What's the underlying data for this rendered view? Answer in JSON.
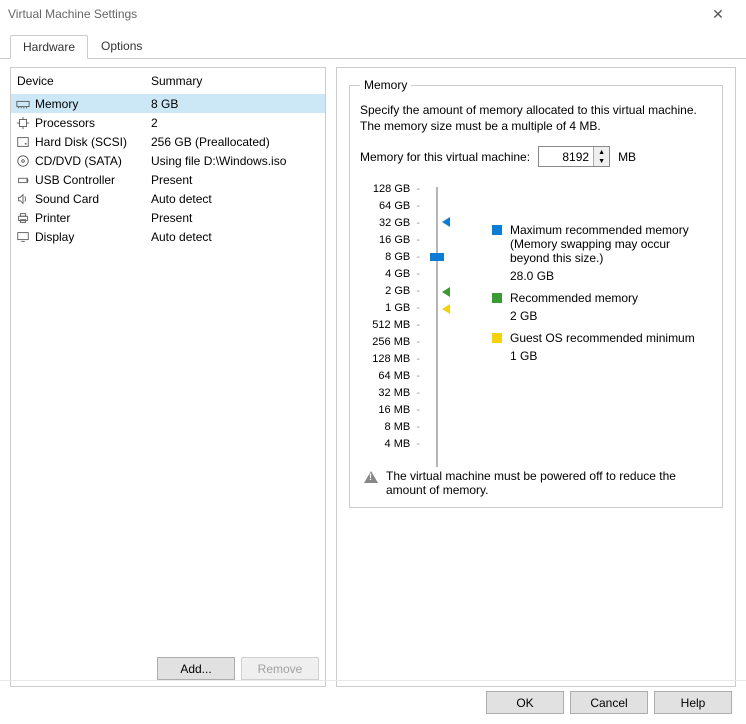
{
  "window": {
    "title": "Virtual Machine Settings"
  },
  "tabs": {
    "hardware": "Hardware",
    "options": "Options"
  },
  "deviceList": {
    "headers": {
      "device": "Device",
      "summary": "Summary"
    },
    "items": [
      {
        "name": "Memory",
        "summary": "8 GB",
        "icon": "memory"
      },
      {
        "name": "Processors",
        "summary": "2",
        "icon": "cpu"
      },
      {
        "name": "Hard Disk (SCSI)",
        "summary": "256 GB (Preallocated)",
        "icon": "disk"
      },
      {
        "name": "CD/DVD (SATA)",
        "summary": "Using file D:\\Windows.iso",
        "icon": "cd"
      },
      {
        "name": "USB Controller",
        "summary": "Present",
        "icon": "usb"
      },
      {
        "name": "Sound Card",
        "summary": "Auto detect",
        "icon": "sound"
      },
      {
        "name": "Printer",
        "summary": "Present",
        "icon": "printer"
      },
      {
        "name": "Display",
        "summary": "Auto detect",
        "icon": "display"
      }
    ],
    "selected": 0,
    "buttons": {
      "add": "Add...",
      "remove": "Remove"
    }
  },
  "memoryPanel": {
    "legend": "Memory",
    "description": "Specify the amount of memory allocated to this virtual machine. The memory size must be a multiple of 4 MB.",
    "label": "Memory for this virtual machine:",
    "value": "8192",
    "unit": "MB",
    "ticks": [
      "128 GB",
      "64 GB",
      "32 GB",
      "16 GB",
      "8 GB",
      "4 GB",
      "2 GB",
      "1 GB",
      "512 MB",
      "256 MB",
      "128 MB",
      "64 MB",
      "32 MB",
      "16 MB",
      "8 MB",
      "4 MB"
    ],
    "legendItems": {
      "max": {
        "color": "#0c7cd5",
        "title": "Maximum recommended memory",
        "sub": "(Memory swapping may occur beyond this size.)",
        "value": "28.0 GB"
      },
      "rec": {
        "color": "#3a9b35",
        "title": "Recommended memory",
        "value": "2 GB"
      },
      "min": {
        "color": "#f4d20b",
        "title": "Guest OS recommended minimum",
        "value": "1 GB"
      }
    },
    "warning": "The virtual machine must be powered off to reduce the amount of memory."
  },
  "footer": {
    "ok": "OK",
    "cancel": "Cancel",
    "help": "Help"
  }
}
